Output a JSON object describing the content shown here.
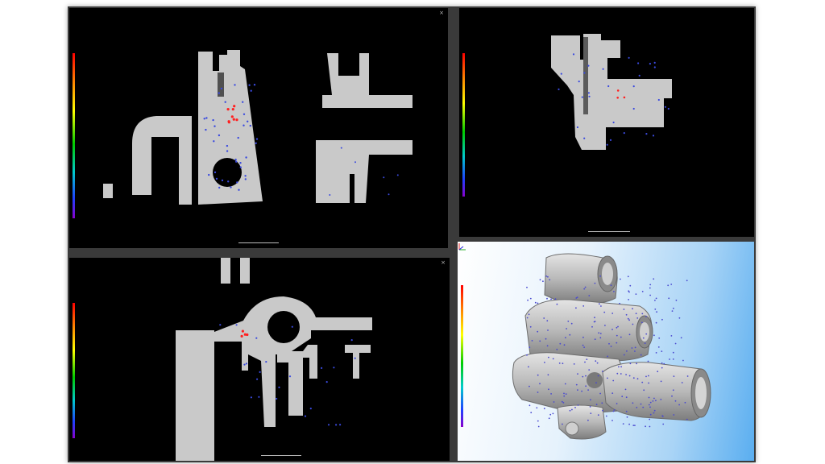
{
  "colors": {
    "frame": "#3a3a3a",
    "viewport_dark": "#000000",
    "part_gray": "#c9c9c9",
    "pore_blue": "#3a4adf",
    "pore_red": "#ff2020",
    "sky_left": "#ffffff",
    "sky_right": "#5aaef0"
  },
  "views": {
    "top_left": {
      "title": "",
      "subtitle": "",
      "legend_title": "",
      "close_label": "×",
      "scale_label": ""
    },
    "top_right": {
      "title": "",
      "subtitle": "",
      "legend_title": "",
      "scale_label": ""
    },
    "bottom_left": {
      "title": "",
      "subtitle": "",
      "legend_title": "",
      "close_label": "×",
      "scale_label": ""
    },
    "bottom_right_3d": {
      "title": "",
      "legend_title": ""
    }
  },
  "icons": {
    "close": "close-icon",
    "axes": "axes-triad-icon"
  }
}
